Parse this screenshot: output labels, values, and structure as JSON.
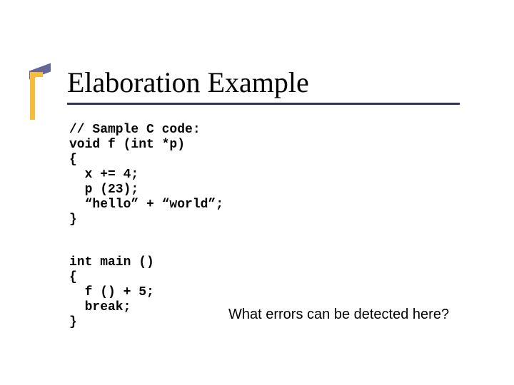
{
  "title": "Elaboration Example",
  "code_block_1": "// Sample C code:\nvoid f (int *p)\n{\n  x += 4;\n  p (23);\n  “hello” + “world”;\n}",
  "code_block_2": "int main ()\n{\n  f () + 5;\n  break;\n}",
  "question": "What errors can be detected here?"
}
